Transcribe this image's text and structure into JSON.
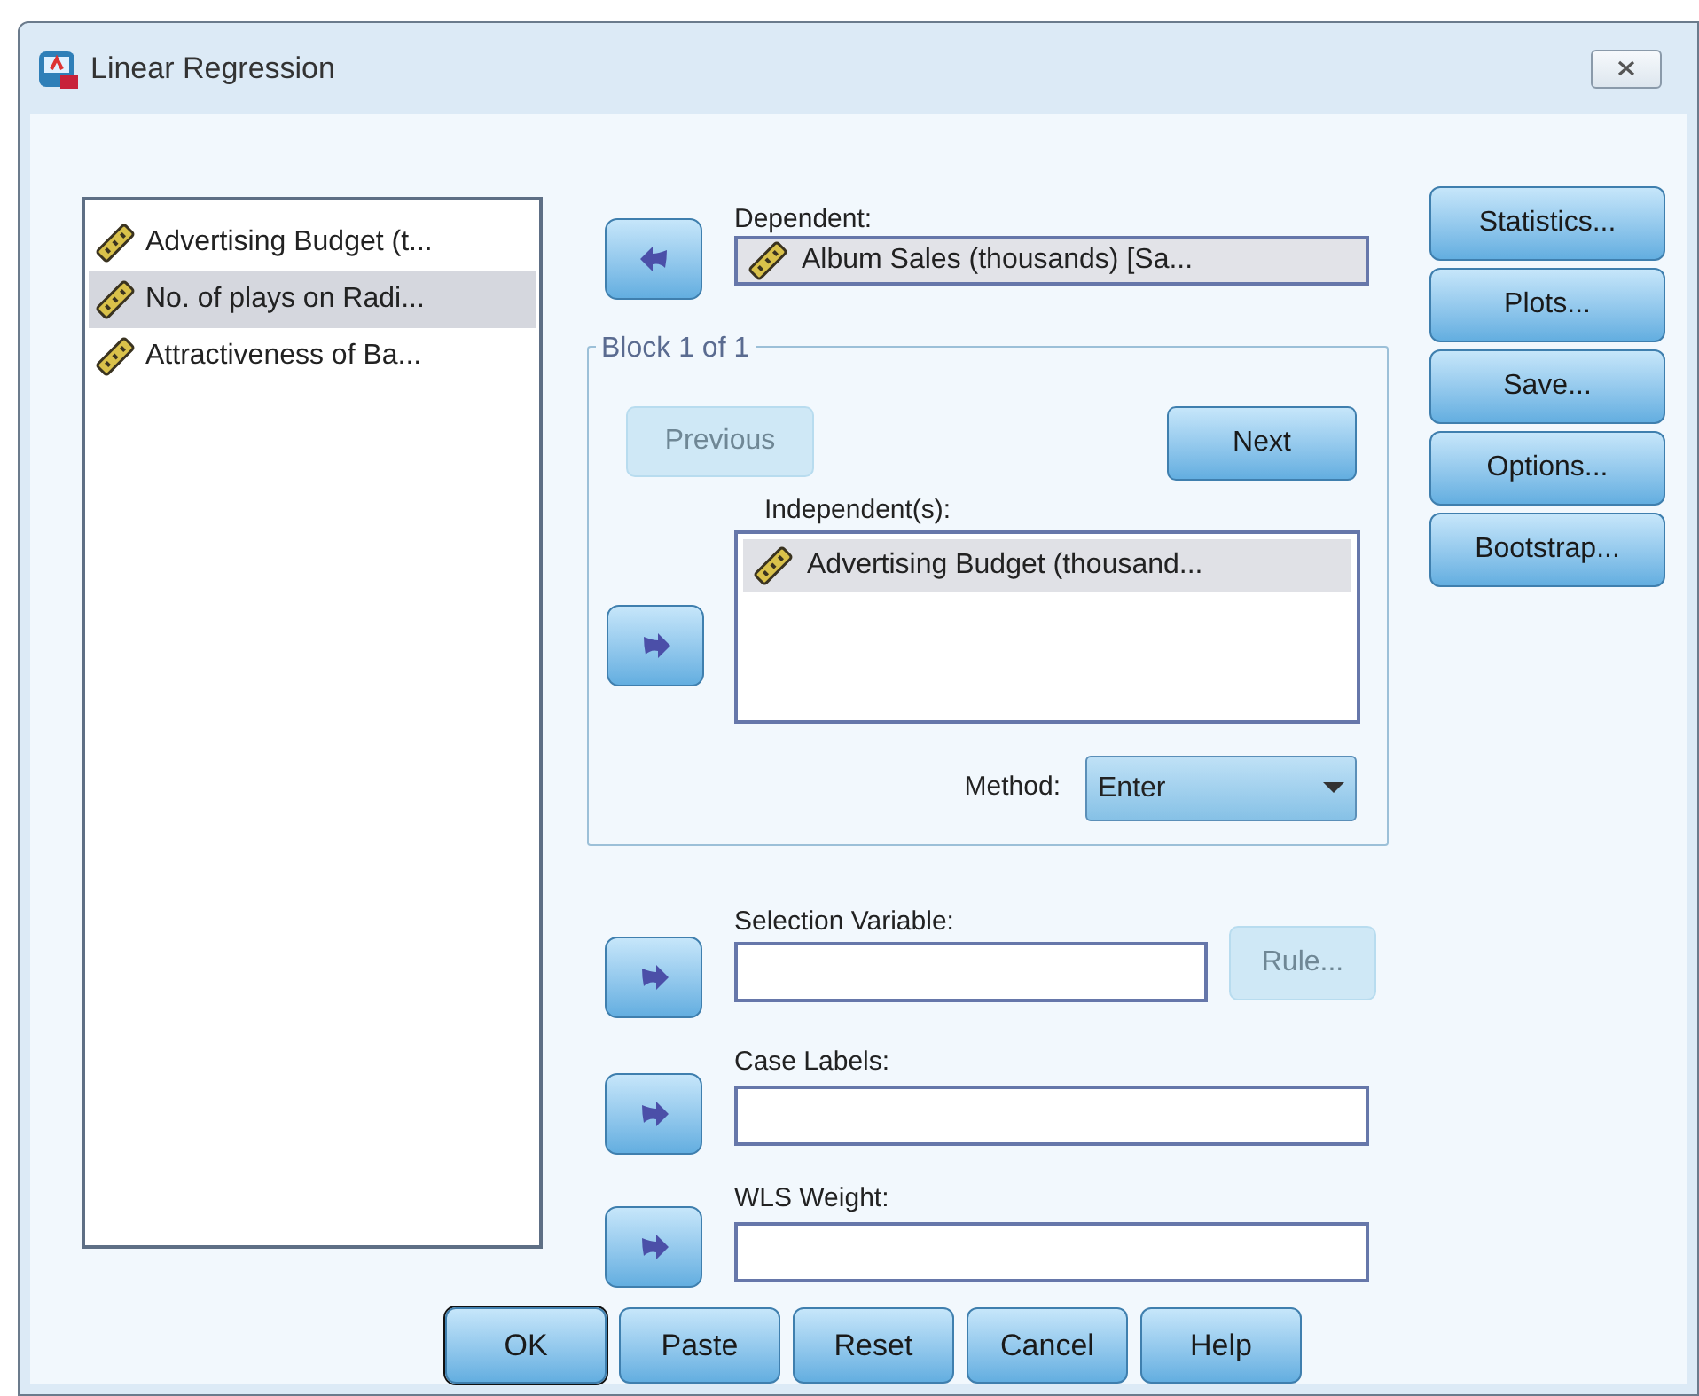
{
  "window": {
    "title": "Linear Regression"
  },
  "variable_list": {
    "items": [
      {
        "label": "Advertising Budget (t...",
        "selected": false
      },
      {
        "label": "No. of plays on Radi...",
        "selected": true
      },
      {
        "label": "Attractiveness of Ba...",
        "selected": false
      }
    ]
  },
  "dependent": {
    "label": "Dependent:",
    "value": "Album Sales (thousands) [Sa..."
  },
  "block": {
    "title": "Block 1 of 1",
    "previous_button": {
      "label": "Previous",
      "disabled": true
    },
    "next_button": {
      "label": "Next",
      "disabled": false
    },
    "independents": {
      "label": "Independent(s):",
      "items": [
        {
          "label": "Advertising Budget (thousand..."
        }
      ]
    },
    "method": {
      "label": "Method:",
      "value": "Enter"
    }
  },
  "selection_variable": {
    "label": "Selection Variable:"
  },
  "rule_button": {
    "label": "Rule...",
    "disabled": true
  },
  "case_labels": {
    "label": "Case Labels:"
  },
  "wls_weight": {
    "label": "WLS Weight:"
  },
  "side_buttons": [
    "Statistics...",
    "Plots...",
    "Save...",
    "Options...",
    "Bootstrap..."
  ],
  "bottom_buttons": [
    {
      "label": "OK",
      "default": true
    },
    {
      "label": "Paste",
      "default": false
    },
    {
      "label": "Reset",
      "default": false
    },
    {
      "label": "Cancel",
      "default": false
    },
    {
      "label": "Help",
      "default": false
    }
  ]
}
